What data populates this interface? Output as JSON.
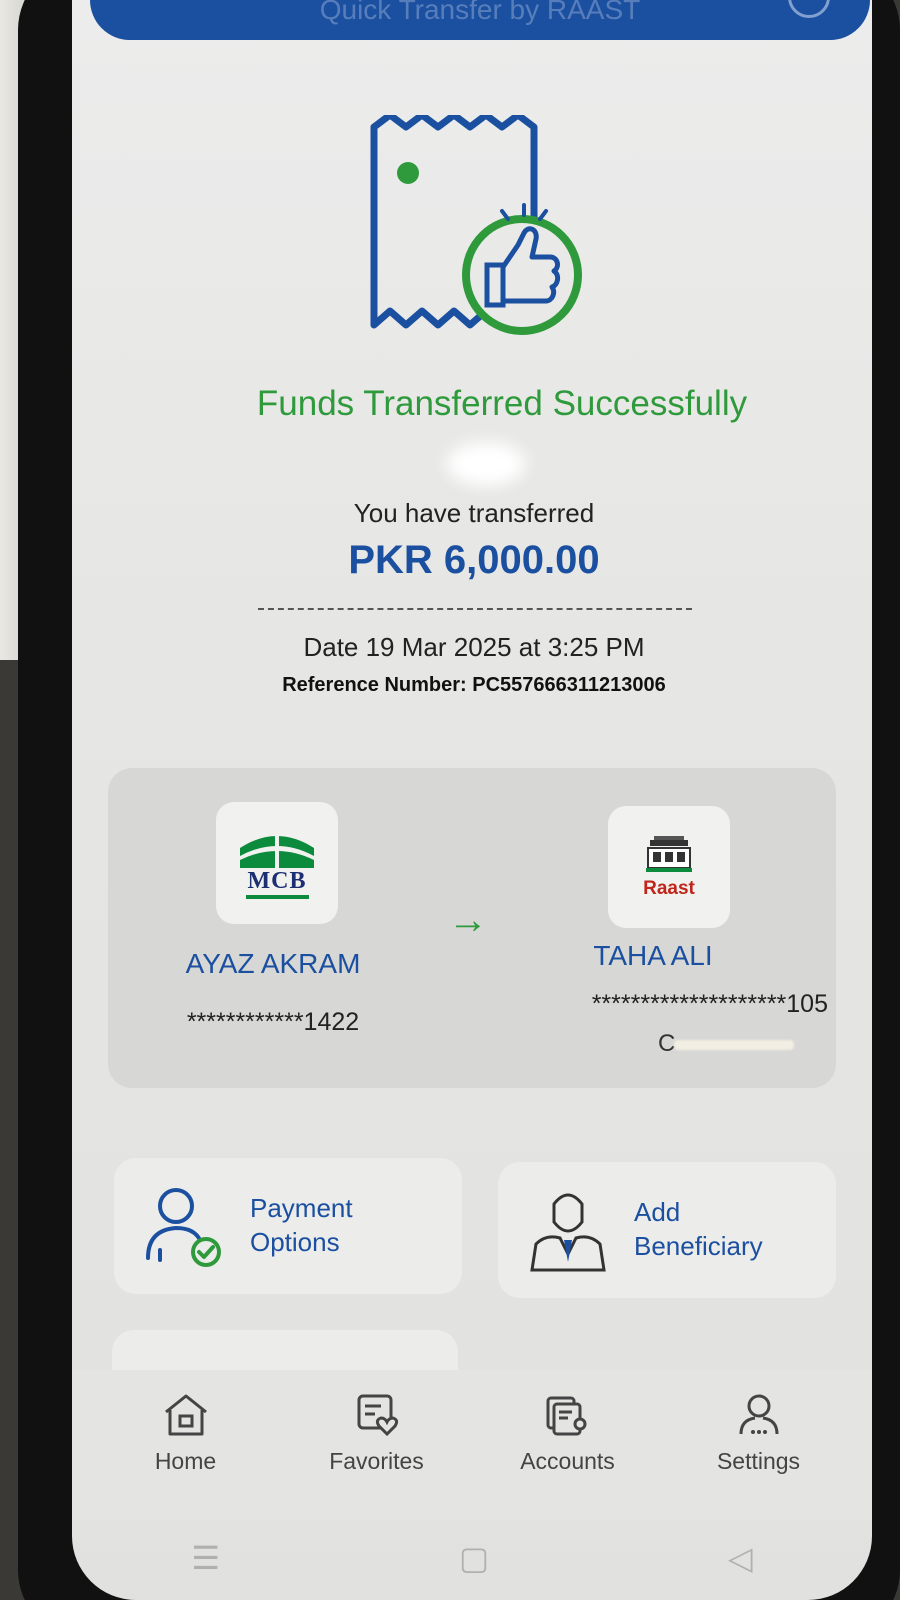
{
  "header": {
    "title": "Quick Transfer by RAAST"
  },
  "status": {
    "title": "Funds Transferred Successfully"
  },
  "summary": {
    "label": "You have transferred",
    "amount": "PKR 6,000.00",
    "date": "Date 19 Mar 2025 at 3:25 PM",
    "reference": "Reference Number: PC557666311213006"
  },
  "sender": {
    "bank_logo_text": "MCB",
    "name": "AYAZ AKRAM",
    "account": "************1422"
  },
  "receiver": {
    "bank_logo_text": "Raast",
    "name": "TAHA ALI",
    "account": "********************105",
    "extra": "C"
  },
  "actions": [
    {
      "label_line1": "Payment",
      "label_line2": "Options",
      "icon": "user-check-icon"
    },
    {
      "label_line1": "Add",
      "label_line2": "Beneficiary",
      "icon": "beneficiary-icon"
    }
  ],
  "nav": [
    {
      "label": "Home",
      "icon": "home-icon"
    },
    {
      "label": "Favorites",
      "icon": "favorites-icon"
    },
    {
      "label": "Accounts",
      "icon": "accounts-icon"
    },
    {
      "label": "Settings",
      "icon": "settings-icon"
    }
  ],
  "colors": {
    "primary": "#1b4fa0",
    "success": "#2f9a3c",
    "raast_red": "#c0261b"
  }
}
